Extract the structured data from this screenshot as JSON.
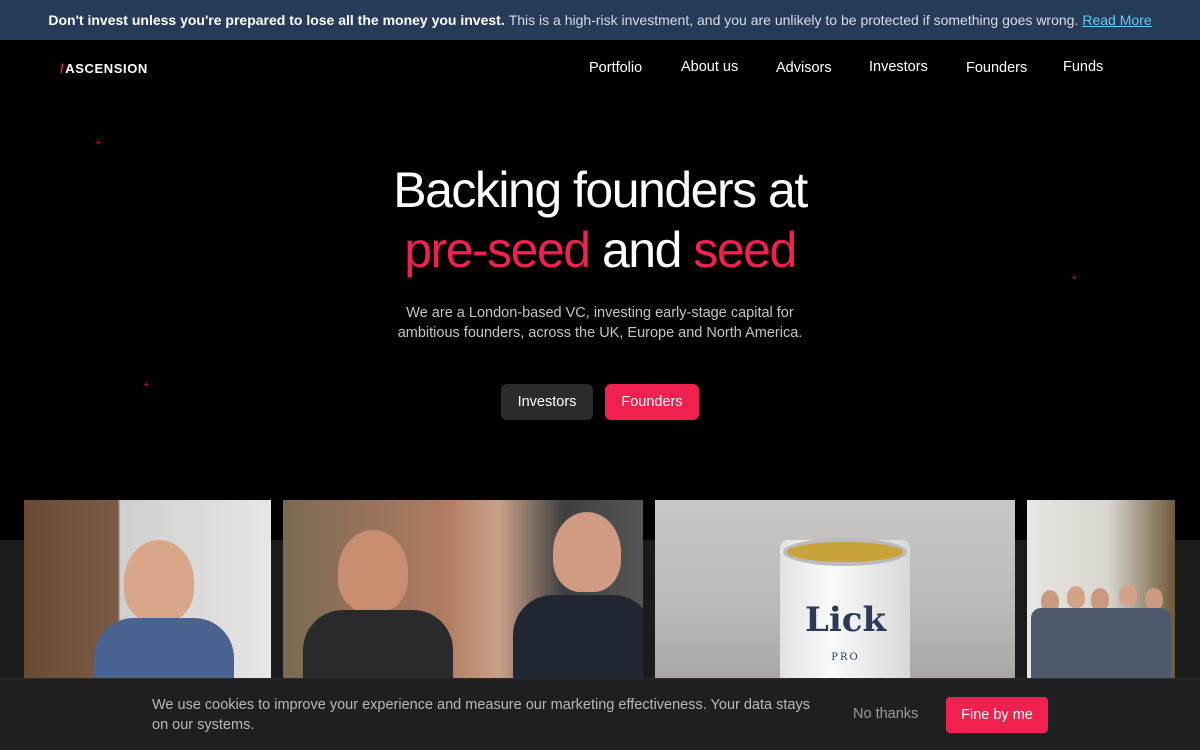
{
  "risk_banner": {
    "bold": "Don't invest unless you're prepared to lose all the money you invest.",
    "text": "This is a high-risk investment, and you are unlikely to be protected if something goes wrong.",
    "link": "Read More"
  },
  "header": {
    "logo_slash": "/",
    "logo_text": "ASCENSION",
    "nav": [
      "Portfolio",
      "About us",
      "Advisors",
      "Investors",
      "Founders",
      "Funds"
    ]
  },
  "hero": {
    "title_line1": "Backing founders at",
    "title_part1": "pre-seed",
    "title_and": "and",
    "title_part2": "seed",
    "subtitle_line1": "We are a London-based VC, investing early-stage capital for",
    "subtitle_line2": "ambitious founders, across the UK, Europe and North America.",
    "button_investors": "Investors",
    "button_founders": "Founders"
  },
  "gallery": {
    "can_brand": "Lick",
    "can_sub": "PRO"
  },
  "cookie_bar": {
    "text": "We use cookies to improve your experience and measure our marketing effectiveness. Your data stays on our systems.",
    "decline": "No thanks",
    "accept": "Fine by me"
  },
  "colors": {
    "accent": "#f0204f",
    "banner_bg": "#263a59",
    "link": "#5fd0f0"
  }
}
